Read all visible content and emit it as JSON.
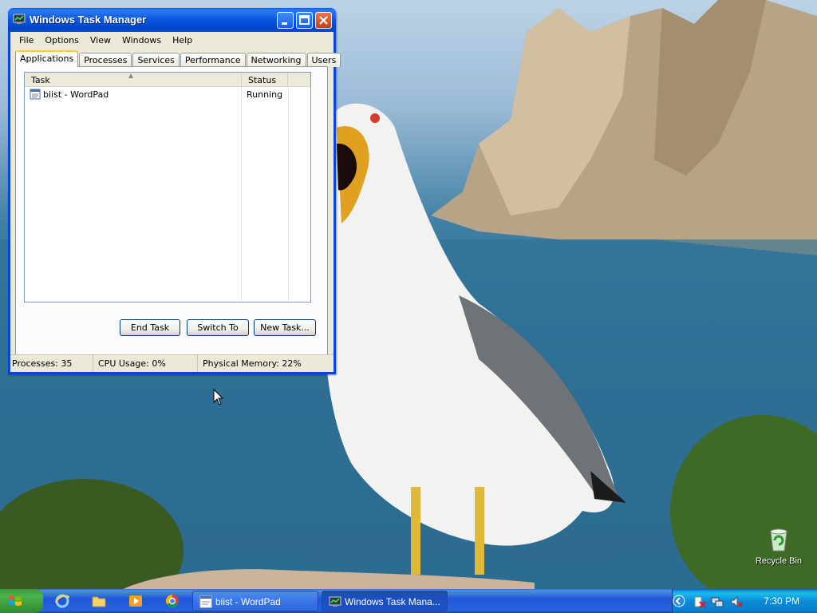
{
  "window": {
    "title": "Windows Task Manager",
    "menu": [
      "File",
      "Options",
      "View",
      "Windows",
      "Help"
    ],
    "tabs": [
      "Applications",
      "Processes",
      "Services",
      "Performance",
      "Networking",
      "Users"
    ],
    "active_tab": "Applications",
    "list": {
      "columns": [
        "Task",
        "Status"
      ],
      "rows": [
        {
          "task": "biist - WordPad",
          "status": "Running"
        }
      ]
    },
    "buttons": {
      "end_task": "End Task",
      "switch_to": "Switch To",
      "new_task": "New Task..."
    },
    "status": {
      "processes": "Processes: 35",
      "cpu": "CPU Usage: 0%",
      "memory": "Physical Memory: 22%"
    }
  },
  "desktop": {
    "icons": [
      {
        "label": "Recycle Bin",
        "icon": "recycle-bin-icon"
      }
    ]
  },
  "taskbar": {
    "quick_launch": [
      "internet-explorer-icon",
      "folder-icon",
      "media-player-icon",
      "chrome-icon"
    ],
    "tasks": [
      {
        "label": "biist - WordPad",
        "icon": "wordpad-icon"
      },
      {
        "label": "Windows Task Mana...",
        "icon": "task-manager-icon"
      }
    ],
    "clock": "7:30 PM"
  },
  "colors": {
    "title_bar": "#0a56e0",
    "taskbar": "#2157d7",
    "start_button": "#3c9a3c",
    "tray": "#0b8bd7"
  }
}
